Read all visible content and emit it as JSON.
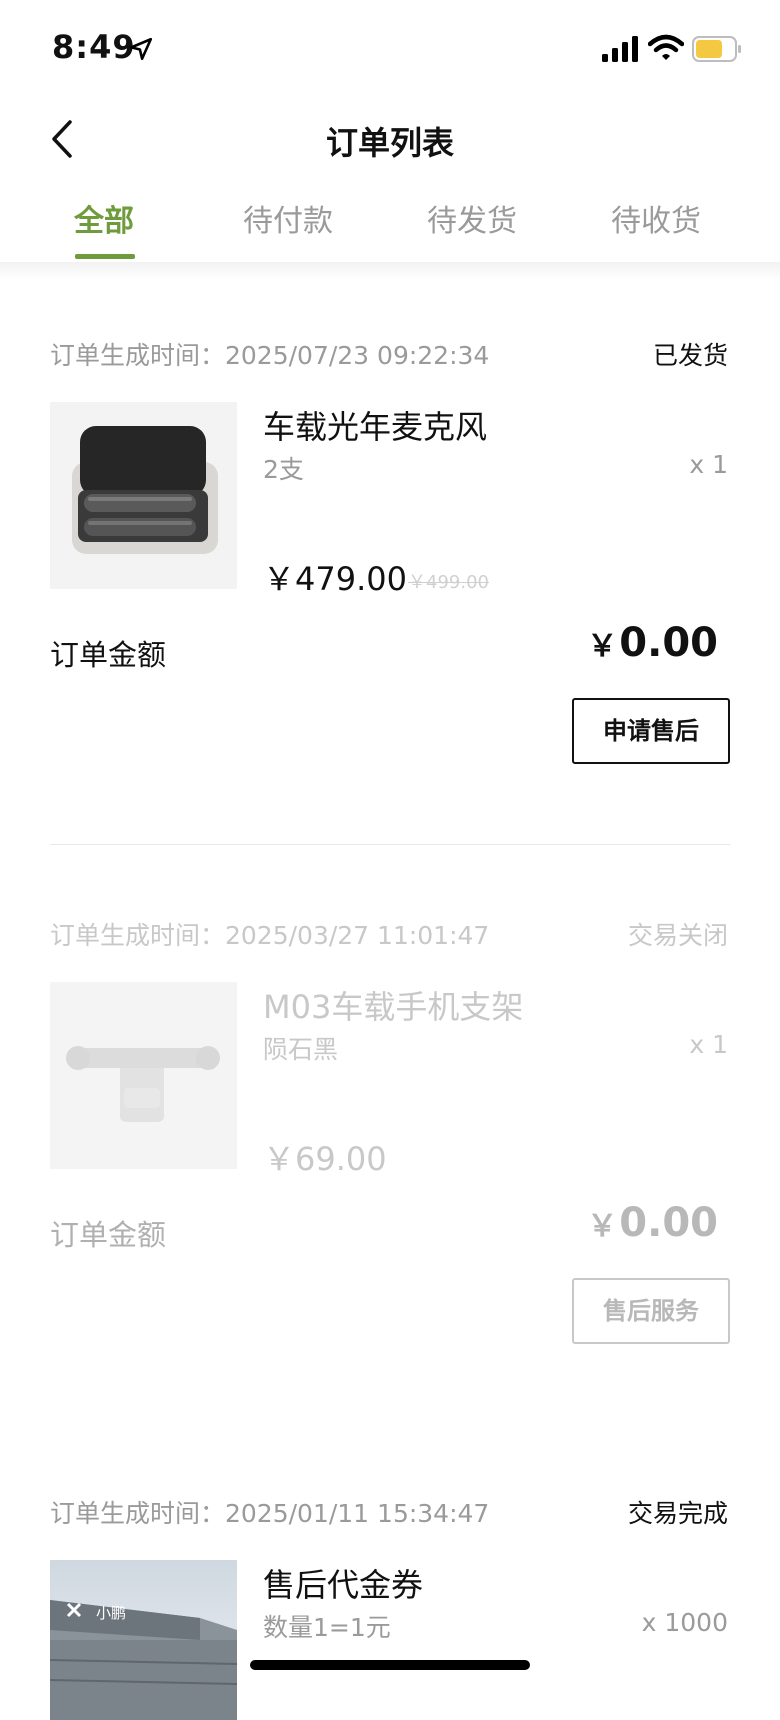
{
  "status_bar": {
    "time": "8:49"
  },
  "header": {
    "title": "订单列表"
  },
  "tabs": [
    {
      "label": "全部",
      "active": true
    },
    {
      "label": "待付款",
      "active": false
    },
    {
      "label": "待发货",
      "active": false
    },
    {
      "label": "待收货",
      "active": false
    }
  ],
  "orders": [
    {
      "time_label": "订单生成时间：2025/07/23 09:22:34",
      "status": "已发货",
      "product_name": "车载光年麦克风",
      "spec": "2支",
      "qty": "x 1",
      "price": "￥479.00",
      "original_price": "￥499.00",
      "amount_label": "订单金额",
      "amount_currency": "￥",
      "amount_value": "0.00",
      "action": "申请售后"
    },
    {
      "time_label": "订单生成时间：2025/03/27 11:01:47",
      "status": "交易关闭",
      "product_name": "M03车载手机支架",
      "spec": "陨石黑",
      "qty": "x 1",
      "price": "￥69.00",
      "amount_label": "订单金额",
      "amount_currency": "￥",
      "amount_value": "0.00",
      "action": "售后服务"
    },
    {
      "time_label": "订单生成时间：2025/01/11 15:34:47",
      "status": "交易完成",
      "product_name": "售后代金券",
      "spec": "数量1=1元",
      "qty": "x 1000",
      "thumb_logo": "小鹏"
    }
  ],
  "colors": {
    "accent": "#6e9b3c",
    "text": "#111111",
    "muted": "#9a9a9a"
  }
}
